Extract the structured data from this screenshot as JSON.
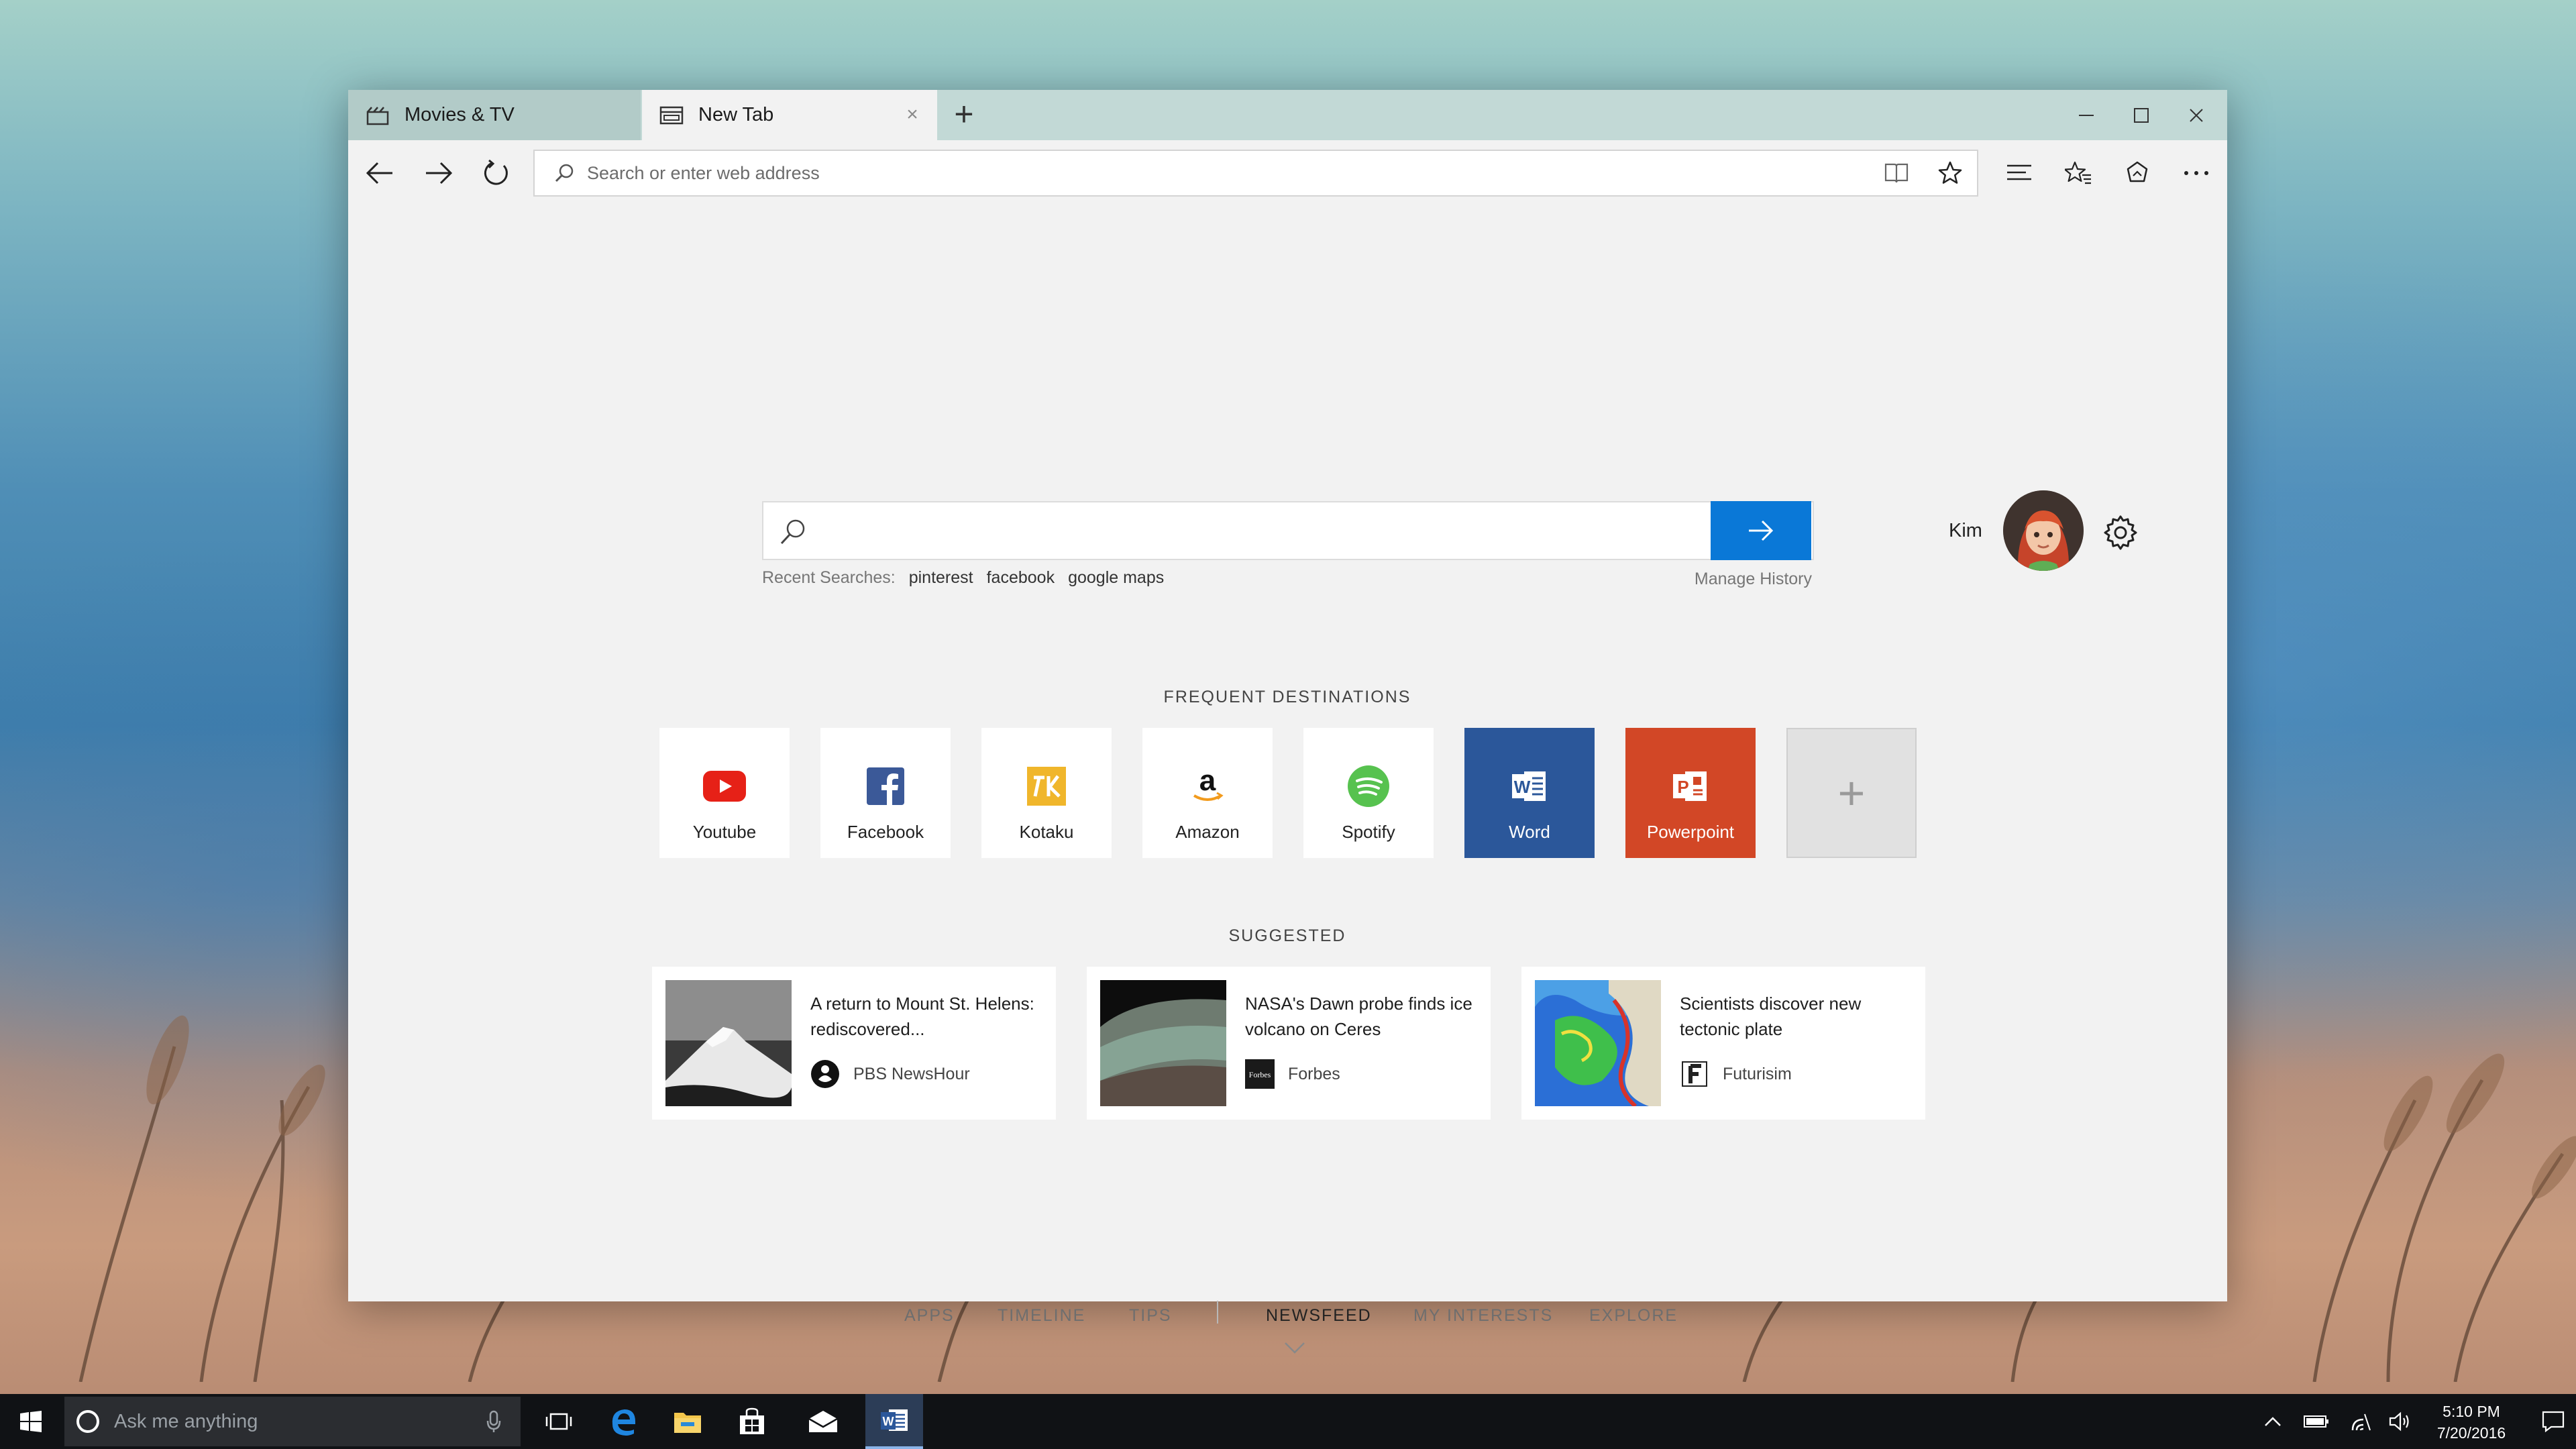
{
  "tabs": [
    {
      "label": "Movies & TV",
      "icon": "clapperboard-icon",
      "active": false
    },
    {
      "label": "New Tab",
      "icon": "tab-page-icon",
      "active": true
    }
  ],
  "window_controls": [
    "minimize-icon",
    "maximize-icon",
    "close-icon"
  ],
  "navigation": {
    "back_icon": "back-arrow-icon",
    "forward_icon": "forward-arrow-icon",
    "refresh_icon": "refresh-icon"
  },
  "address_bar": {
    "placeholder": "Search or enter web address",
    "value": "",
    "reading_view_icon": "book-icon",
    "favorite_icon": "star-icon"
  },
  "toolbar_right": [
    "hub-icon",
    "notes-icon",
    "share-icon",
    "more-icon"
  ],
  "search": {
    "placeholder": "",
    "recent_label": "Recent Searches:",
    "recent_items": [
      "pinterest",
      "facebook",
      "google maps"
    ],
    "manage_history": "Manage History"
  },
  "profile": {
    "name": "Kim"
  },
  "frequent": {
    "title": "FREQUENT DESTINATIONS",
    "items": [
      {
        "label": "Youtube",
        "icon": "youtube-icon",
        "color": "#e62117"
      },
      {
        "label": "Facebook",
        "icon": "facebook-icon",
        "color": "#3b5998"
      },
      {
        "label": "Kotaku",
        "icon": "kotaku-icon",
        "color": "#f0b62b"
      },
      {
        "label": "Amazon",
        "icon": "amazon-icon",
        "color": "#f29b1d"
      },
      {
        "label": "Spotify",
        "icon": "spotify-icon",
        "color": "#57c24f"
      },
      {
        "label": "Word",
        "icon": "word-icon",
        "color": "#2b579a"
      },
      {
        "label": "Powerpoint",
        "icon": "powerpoint-icon",
        "color": "#d24726"
      }
    ],
    "add_label": "+"
  },
  "suggested": {
    "title": "SUGGESTED",
    "cards": [
      {
        "headline": "A return to Mount St. Helens: rediscovered...",
        "source": "PBS NewsHour",
        "source_icon": "pbs-icon"
      },
      {
        "headline": "NASA's Dawn probe finds ice volcano on Ceres",
        "source": "Forbes",
        "source_icon": "forbes-icon"
      },
      {
        "headline": "Scientists discover new tectonic plate",
        "source": "Futurisim",
        "source_icon": "futurism-icon"
      }
    ]
  },
  "bottom_nav": {
    "left": [
      "APPS",
      "TIMELINE",
      "TIPS"
    ],
    "right": [
      "NEWSFEED",
      "MY INTERESTS",
      "EXPLORE"
    ],
    "active": "NEWSFEED"
  },
  "taskbar": {
    "search_placeholder": "Ask me anything",
    "apps": [
      "task-view-icon",
      "edge-icon",
      "file-explorer-icon",
      "store-icon",
      "mail-icon",
      "word-icon"
    ],
    "active_app": "word-icon",
    "tray_icons": [
      "chevron-up-icon",
      "battery-icon",
      "wifi-icon",
      "volume-icon",
      "notification-icon"
    ],
    "time": "5:10 PM",
    "date": "7/20/2016"
  },
  "colors": {
    "accent": "#0a78d7",
    "tab_bar": "#c2d9d6",
    "window_bg": "#f2f2f2",
    "taskbar": "#101215"
  }
}
